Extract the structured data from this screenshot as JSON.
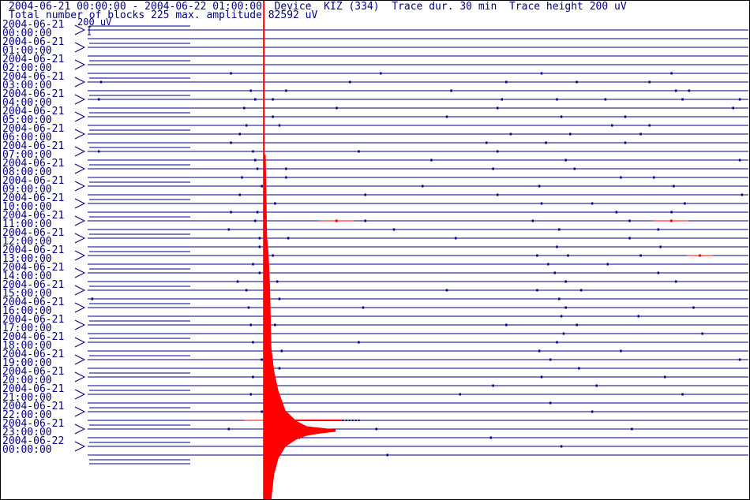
{
  "header": {
    "line1": "2004-06-21 00:00:00 - 2004-06-22 01:00:00  Device  KIZ (334)  Trace dur. 30 min  Trace height 200 uV",
    "line2": "Total number of blocks 225 max. amplitude 82592 uV"
  },
  "chart_data": {
    "type": "line",
    "title": "2004-06-21 00:00:00 - 2004-06-22 01:00:00  Device  KIZ (334)  Trace dur. 30 min  Trace height 200 uV",
    "subtitle": "Total number of blocks 225 max. amplitude 82592 uV",
    "device": "KIZ (334)",
    "trace_duration": "30 min",
    "trace_height": "200 uV",
    "scale_label": "200 uV",
    "total_blocks": 225,
    "max_amplitude_uV": 82592,
    "trace_count": 50,
    "trace_minutes": [
      0,
      30
    ],
    "row_labels": [
      {
        "date": "2004-06-21",
        "time": "00:00:00"
      },
      {
        "date": "2004-06-21",
        "time": "01:00:00"
      },
      {
        "date": "2004-06-21",
        "time": "02:00:00"
      },
      {
        "date": "2004-06-21",
        "time": "03:00:00"
      },
      {
        "date": "2004-06-21",
        "time": "04:00:00"
      },
      {
        "date": "2004-06-21",
        "time": "05:00:00"
      },
      {
        "date": "2004-06-21",
        "time": "06:00:00"
      },
      {
        "date": "2004-06-21",
        "time": "07:00:00"
      },
      {
        "date": "2004-06-21",
        "time": "08:00:00"
      },
      {
        "date": "2004-06-21",
        "time": "09:00:00"
      },
      {
        "date": "2004-06-21",
        "time": "10:00:00"
      },
      {
        "date": "2004-06-21",
        "time": "11:00:00"
      },
      {
        "date": "2004-06-21",
        "time": "12:00:00"
      },
      {
        "date": "2004-06-21",
        "time": "13:00:00"
      },
      {
        "date": "2004-06-21",
        "time": "14:00:00"
      },
      {
        "date": "2004-06-21",
        "time": "15:00:00"
      },
      {
        "date": "2004-06-21",
        "time": "16:00:00"
      },
      {
        "date": "2004-06-21",
        "time": "17:00:00"
      },
      {
        "date": "2004-06-21",
        "time": "18:00:00"
      },
      {
        "date": "2004-06-21",
        "time": "19:00:00"
      },
      {
        "date": "2004-06-21",
        "time": "20:00:00"
      },
      {
        "date": "2004-06-21",
        "time": "21:00:00"
      },
      {
        "date": "2004-06-21",
        "time": "22:00:00"
      },
      {
        "date": "2004-06-21",
        "time": "23:00:00"
      },
      {
        "date": "2004-06-22",
        "time": "00:00:00"
      }
    ],
    "events": [
      {
        "trace": 45,
        "minute": 8.0,
        "type": "earthquake",
        "peak_uV": 82592,
        "coda_end_minute": 11.6
      }
    ],
    "blips": [
      [
        5,
        6.5
      ],
      [
        5,
        13.3
      ],
      [
        5,
        20.6
      ],
      [
        5,
        26.5
      ],
      [
        6,
        0.6
      ],
      [
        6,
        11.9
      ],
      [
        6,
        19.0
      ],
      [
        6,
        22.2
      ],
      [
        6,
        25.5
      ],
      [
        7,
        7.4
      ],
      [
        7,
        9.0
      ],
      [
        7,
        16.5
      ],
      [
        7,
        26.7
      ],
      [
        7,
        27.3
      ],
      [
        8,
        0.5
      ],
      [
        8,
        7.6
      ],
      [
        8,
        8.4
      ],
      [
        8,
        18.8
      ],
      [
        8,
        21.3
      ],
      [
        8,
        23.5
      ],
      [
        8,
        27.0
      ],
      [
        8,
        29.6
      ],
      [
        9,
        7.1
      ],
      [
        9,
        11.3
      ],
      [
        9,
        18.6
      ],
      [
        9,
        29.3
      ],
      [
        10,
        8.4
      ],
      [
        10,
        16.3
      ],
      [
        10,
        21.5
      ],
      [
        10,
        24.4
      ],
      [
        11,
        7.2
      ],
      [
        11,
        8.7
      ],
      [
        11,
        23.8
      ],
      [
        11,
        25.5
      ],
      [
        12,
        6.9
      ],
      [
        12,
        19.2
      ],
      [
        12,
        21.9
      ],
      [
        12,
        25.1
      ],
      [
        13,
        6.5
      ],
      [
        13,
        18.1
      ],
      [
        13,
        20.8
      ],
      [
        13,
        24.4
      ],
      [
        14,
        0.5
      ],
      [
        14,
        7.5
      ],
      [
        14,
        12.3
      ],
      [
        14,
        18.6
      ],
      [
        14,
        30.1
      ],
      [
        15,
        7.6
      ],
      [
        15,
        15.6
      ],
      [
        15,
        21.7
      ],
      [
        15,
        29.6
      ],
      [
        16,
        7.7
      ],
      [
        16,
        9.0
      ],
      [
        16,
        18.4
      ],
      [
        16,
        22.1
      ],
      [
        17,
        7.0
      ],
      [
        17,
        9.0
      ],
      [
        17,
        24.2
      ],
      [
        17,
        25.7
      ],
      [
        18,
        7.9
      ],
      [
        18,
        15.2
      ],
      [
        18,
        20.5
      ],
      [
        18,
        26.6
      ],
      [
        19,
        6.9
      ],
      [
        19,
        12.6
      ],
      [
        19,
        18.6
      ],
      [
        19,
        29.7
      ],
      [
        20,
        8.5
      ],
      [
        20,
        20.6
      ],
      [
        20,
        22.9
      ],
      [
        20,
        27.1
      ],
      [
        21,
        6.5
      ],
      [
        21,
        7.7
      ],
      [
        21,
        24.0
      ],
      [
        21,
        26.5
      ],
      [
        22,
        7.6
      ],
      [
        22,
        12.6
      ],
      [
        22,
        20.2
      ],
      [
        22,
        24.6
      ],
      [
        23,
        6.4
      ],
      [
        23,
        13.9
      ],
      [
        23,
        21.4
      ],
      [
        23,
        25.9
      ],
      [
        24,
        7.8
      ],
      [
        24,
        9.1
      ],
      [
        24,
        16.7
      ],
      [
        24,
        24.6
      ],
      [
        25,
        7.8
      ],
      [
        25,
        21.3
      ],
      [
        25,
        26.0
      ],
      [
        26,
        8.4
      ],
      [
        26,
        20.4
      ],
      [
        26,
        21.8
      ],
      [
        26,
        25.1
      ],
      [
        27,
        7.5
      ],
      [
        27,
        20.9
      ],
      [
        27,
        23.6
      ],
      [
        28,
        7.8
      ],
      [
        28,
        21.2
      ],
      [
        28,
        25.9
      ],
      [
        29,
        6.8
      ],
      [
        29,
        8.6
      ],
      [
        29,
        21.7
      ],
      [
        29,
        26.7
      ],
      [
        30,
        7.2
      ],
      [
        30,
        16.3
      ],
      [
        30,
        20.4
      ],
      [
        30,
        22.4
      ],
      [
        31,
        0.2
      ],
      [
        31,
        8.7
      ],
      [
        31,
        21.4
      ],
      [
        32,
        7.3
      ],
      [
        32,
        12.5
      ],
      [
        32,
        21.7
      ],
      [
        32,
        27.5
      ],
      [
        33,
        8.2
      ],
      [
        33,
        21.5
      ],
      [
        33,
        25.0
      ],
      [
        34,
        7.4
      ],
      [
        34,
        8.5
      ],
      [
        34,
        19.0
      ],
      [
        34,
        22.2
      ],
      [
        35,
        8.1
      ],
      [
        35,
        21.6
      ],
      [
        35,
        27.9
      ],
      [
        36,
        7.5
      ],
      [
        36,
        12.3
      ],
      [
        36,
        21.3
      ],
      [
        37,
        8.8
      ],
      [
        37,
        20.5
      ],
      [
        37,
        24.2
      ],
      [
        38,
        7.9
      ],
      [
        38,
        21.0
      ],
      [
        38,
        29.6
      ],
      [
        39,
        8.7
      ],
      [
        39,
        22.3
      ],
      [
        40,
        7.5
      ],
      [
        40,
        20.6
      ],
      [
        40,
        26.2
      ],
      [
        41,
        8.0
      ],
      [
        41,
        18.4
      ],
      [
        41,
        23.1
      ],
      [
        42,
        7.4
      ],
      [
        42,
        16.9
      ],
      [
        42,
        27.0
      ],
      [
        43,
        8.5
      ],
      [
        43,
        21.0
      ],
      [
        44,
        7.9
      ],
      [
        44,
        22.9
      ],
      [
        46,
        6.4
      ],
      [
        46,
        13.1
      ],
      [
        46,
        24.7
      ],
      [
        47,
        9.6
      ],
      [
        47,
        18.3
      ],
      [
        48,
        8.9
      ],
      [
        48,
        21.5
      ],
      [
        49,
        13.6
      ]
    ],
    "red_segments": [
      {
        "trace": 22,
        "start_minute": 10.5,
        "end_minute": 12.1
      },
      {
        "trace": 22,
        "start_minute": 25.7,
        "end_minute": 27.3
      },
      {
        "trace": 26,
        "start_minute": 27.2,
        "end_minute": 28.4
      }
    ],
    "colors": {
      "trace": "#000080",
      "event": "#ff0000",
      "text": "#000080",
      "frame": "#000000"
    }
  }
}
